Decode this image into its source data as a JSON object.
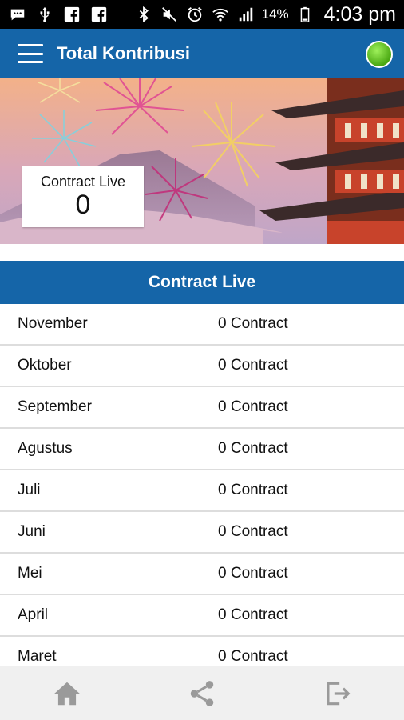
{
  "status_bar": {
    "battery": "14%",
    "time": "4:03 pm",
    "left_icons": [
      "chat-icon",
      "usb-icon",
      "facebook-icon",
      "facebook-icon"
    ],
    "right_icons": [
      "bluetooth-icon",
      "mute-icon",
      "alarm-icon",
      "wifi-icon",
      "signal-icon",
      "battery-icon"
    ]
  },
  "app_bar": {
    "title": "Total Kontribusi",
    "status_color": "#5fc41f"
  },
  "banner": {
    "card_label": "Contract Live",
    "card_value": "0"
  },
  "section": {
    "title": "Contract Live"
  },
  "rows": [
    {
      "month": "November",
      "count": "0 Contract"
    },
    {
      "month": "Oktober",
      "count": "0 Contract"
    },
    {
      "month": "September",
      "count": "0 Contract"
    },
    {
      "month": "Agustus",
      "count": "0 Contract"
    },
    {
      "month": "Juli",
      "count": "0 Contract"
    },
    {
      "month": "Juni",
      "count": "0 Contract"
    },
    {
      "month": "Mei",
      "count": "0 Contract"
    },
    {
      "month": "April",
      "count": "0 Contract"
    },
    {
      "month": "Maret",
      "count": "0 Contract"
    }
  ],
  "bottom_nav": [
    "home-icon",
    "share-icon",
    "logout-icon"
  ],
  "colors": {
    "primary": "#1565a8",
    "divider": "#dddddd",
    "bottom_bar": "#f0f0f0",
    "nav_icon": "#9a9a9a"
  }
}
